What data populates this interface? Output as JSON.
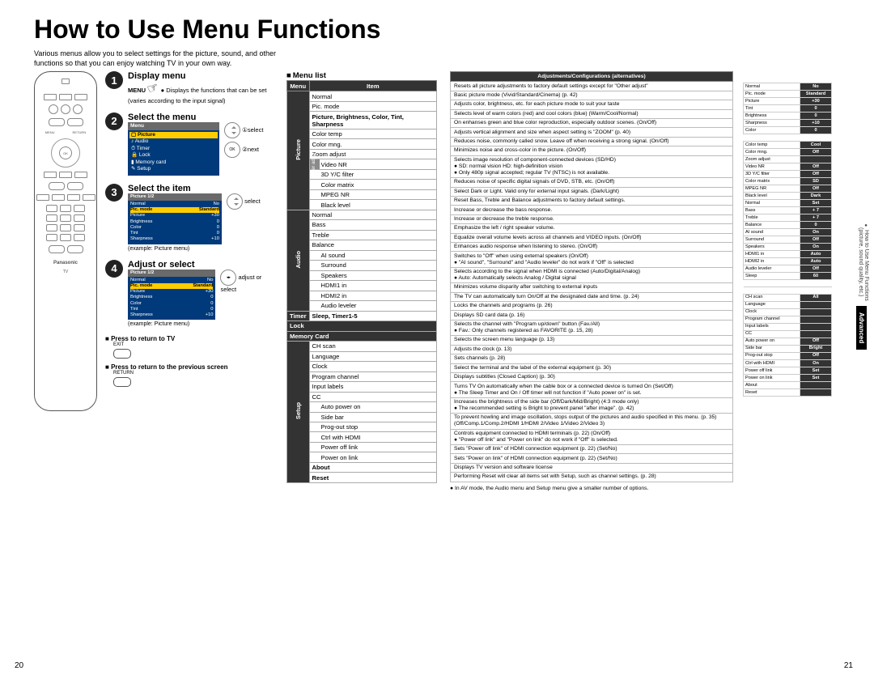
{
  "title": "How to Use Menu Functions",
  "intro": "Various menus allow you to select settings for the picture, sound, and other functions so that you can enjoy watching TV in your own way.",
  "sidetab": {
    "advanced": "Advanced",
    "line1": "How to Use Menu Functions",
    "line2": "(picture, sound quality, etc.)"
  },
  "pageLeft": "20",
  "pageRight": "21",
  "steps": {
    "s1": {
      "title": "Display menu",
      "menu_label": "MENU",
      "desc": "Displays the functions that can be set (varies according to the input signal)"
    },
    "s2": {
      "title": "Select the menu",
      "sel": "select",
      "next": "next",
      "osd": {
        "header": "Menu",
        "items": [
          "Picture",
          "Audio",
          "Timer",
          "Lock",
          "Memory card",
          "Setup"
        ]
      }
    },
    "s3": {
      "title": "Select the item",
      "sel": "select",
      "example": "(example: Picture menu)",
      "osd": {
        "header": "Picture   1/2",
        "rows": [
          [
            "Normal",
            "No"
          ],
          [
            "Pic. mode",
            "Standard"
          ],
          [
            "Picture",
            "+30"
          ],
          [
            "Brightness",
            "0"
          ],
          [
            "Color",
            "0"
          ],
          [
            "Tint",
            "0"
          ],
          [
            "Sharpness",
            "+10"
          ]
        ]
      }
    },
    "s4": {
      "title": "Adjust or select",
      "adj": "adjust or select",
      "example": "(example: Picture menu)",
      "osd": {
        "header": "Picture   1/2",
        "rows": [
          [
            "Normal",
            "No"
          ],
          [
            "Pic. mode",
            "Standard"
          ],
          [
            "Picture",
            "+30"
          ],
          [
            "Brightness",
            "0"
          ],
          [
            "Color",
            "0"
          ],
          [
            "Tint",
            "0"
          ],
          [
            "Sharpness",
            "+10"
          ]
        ]
      }
    }
  },
  "press": {
    "p1": {
      "title": "Press to return to TV",
      "label": "EXIT"
    },
    "p2": {
      "title": "Press to return to the previous screen",
      "label": "RETURN"
    }
  },
  "remote": {
    "brand": "Panasonic",
    "tv": "TV"
  },
  "menulist_title": "Menu list",
  "ml_head": {
    "c1": "Menu",
    "c2": "Item"
  },
  "ml": {
    "picture": {
      "cat": "Picture",
      "rows": [
        "Normal",
        "Pic. mode",
        "Picture, Brightness, Color, Tint, Sharpness",
        "Color temp",
        "Color mng.",
        "Zoom adjust"
      ],
      "other_label": "Other adjust",
      "other": [
        "Video NR",
        "3D Y/C filter",
        "Color matrix",
        "MPEG NR",
        "Black level"
      ]
    },
    "audio": {
      "cat": "Audio",
      "rows": [
        "Normal",
        "Bass",
        "Treble",
        "Balance"
      ],
      "other_label": "Other adjust",
      "other": [
        "AI sound",
        "Surround",
        "Speakers",
        "HDMI1 in",
        "HDMI2 in",
        "Audio leveler"
      ]
    },
    "timer": {
      "cat": "Timer",
      "row": "Sleep, Timer1-5"
    },
    "lock": {
      "cat": "Lock"
    },
    "memory": {
      "cat": "Memory Card"
    },
    "setup": {
      "cat": "Setup",
      "rows": [
        "CH scan",
        "Language",
        "Clock",
        "Program channel",
        "Input labels",
        "CC"
      ],
      "other_label": "Other adjust",
      "other": [
        "Auto power on",
        "Side bar",
        "Prog-out stop",
        "Ctrl with HDMI",
        "Power off link",
        "Power on link"
      ],
      "tail": [
        "About",
        "Reset"
      ]
    }
  },
  "adj_head": "Adjustments/Configurations (alternatives)",
  "adj": [
    "Resets all picture adjustments to factory default settings except for \"Other adjust\"",
    "Basic picture mode (Vivid/Standard/Cinema) (p. 42)",
    "Adjusts color, brightness, etc. for each picture mode to suit your taste",
    "Selects level of warm colors (red) and cool colors (blue) (Warm/Cool/Normal)",
    "On enhanses green and blue color reproduction, especially outdoor scenes. (On/Off)",
    "Adjusts vertical alignment and size when aspect setting is \"ZOOM\" (p. 40)",
    "Reduces noise, commonly called snow. Leave off when receiving a strong signal. (On/Off)",
    "Minimizes noise and cross-color in the picture. (On/Off)",
    "Selects image resolution of component-connected devices (SD/HD)\n● SD: normal vision     HD: high-definition vision\n● Only 480p signal accepted; regular TV (NTSC) is not available.",
    "Reduces noise of specific digital signals of DVD, STB, etc. (On/Off)",
    "Select Dark or Light. Valid only for external input signals. (Dark/Light)",
    "Reset Bass, Treble and Balance adjustments to factory default settings.",
    "Increase or decrease the bass response.",
    "Increase or decrease the treble response.",
    "Emphasize the left / right speaker volume.",
    "Equalize overall volume levels across all channels and VIDEO inputs. (On/Off)",
    "Enhances audio response when listening to stereo. (On/Off)",
    "Switches to \"Off\" when using external speakers (On/Off)\n● \"AI sound\", \"Surround\" and \"Audio leveler\" do not work if \"Off\" is selected",
    "Selects according to the signal when HDMI is connected (Auto/Digital/Analog)\n● Auto: Automatically selects Analog / Digital signal",
    "Minimizes volume disparity after switching to external inputs",
    "The TV can automatically turn On/Off at the designated date and time. (p. 24)",
    "Locks the channels and programs (p. 26)",
    "Displays SD card data (p. 16)",
    "Selects the channel with \"Program up/down\" button (Fav./All)\n● Fav.: Only channels registered as FAVORITE (p. 15, 28)",
    "Selects the screen menu language (p. 13)",
    "Adjusts the clock (p. 13)",
    "Sets channels (p. 28)",
    "Select the terminal and the label of the external equipment (p. 30)",
    "Displays subtitles (Closed Caption) (p. 30)",
    "Turns TV On automatically when the cable box or a connected device is turned On (Set/Off)\n● The Sleep Timer and On / Off timer will not function if \"Auto power on\" is set.",
    "Increases the brightness of the side bar (Off/Dark/Mid/Bright) (4:3 mode only)\n● The recommended setting is Bright to prevent panel \"after image\". (p. 42)",
    "To prevent howling and image oscillation, stops output of the pictures and audio specified in this menu. (p. 35) (Off/Comp.1/Comp.2/HDMI 1/HDMI 2/Video 1/Video 2/Video 3)",
    "Controls equipment connected to HDMI terminals (p. 22) (On/Off)\n● \"Power off link\" and \"Power on link\" do not work if \"Off\" is selected.",
    "Sets \"Power off link\" of HDMI connection equipment (p. 22) (Set/No)",
    "Sets \"Power on link\" of HDMI connection equipment (p. 22) (Set/No)",
    "Displays TV version and software license",
    "Performing Reset will clear all items set with Setup, such as channel settings. (p. 28)"
  ],
  "footnote": "● In AV mode, the Audio menu and Setup menu give a smaller number of options.",
  "mini": [
    [
      "Normal",
      "No"
    ],
    [
      "Pic. mode",
      "Standard"
    ],
    [
      "Picture",
      "+30"
    ],
    [
      "Tint",
      "0"
    ],
    [
      "Brightness",
      "0"
    ],
    [
      "Sharpness",
      "+10"
    ],
    [
      "Color",
      "0"
    ],
    [
      "",
      ""
    ],
    [
      "Color temp",
      "Cool"
    ],
    [
      "Color mng.",
      "Off"
    ],
    [
      "Zoom adjust",
      ""
    ],
    [
      "Video NR",
      "Off"
    ],
    [
      "3D Y/C filter",
      "Off"
    ],
    [
      "Color matrix",
      "SD"
    ],
    [
      "MPEG NR",
      "Off"
    ],
    [
      "Black level",
      "Dark"
    ],
    [
      "Normal",
      "Set"
    ],
    [
      "Bass",
      "+ 7"
    ],
    [
      "Treble",
      "+ 7"
    ],
    [
      "Balance",
      "0"
    ],
    [
      "AI sound",
      "On"
    ],
    [
      "Surround",
      "Off"
    ],
    [
      "Speakers",
      "On"
    ],
    [
      "HDMI1 in",
      "Auto"
    ],
    [
      "HDMI2 in",
      "Auto"
    ],
    [
      "Audio leveler",
      "Off"
    ],
    [
      "Sleep",
      "60"
    ],
    [
      "",
      ""
    ],
    [
      "",
      ""
    ],
    [
      "CH scan",
      "All"
    ],
    [
      "Language",
      ""
    ],
    [
      "Clock",
      ""
    ],
    [
      "Program channel",
      ""
    ],
    [
      "Input labels",
      ""
    ],
    [
      "CC",
      ""
    ],
    [
      "Auto power on",
      "Off"
    ],
    [
      "Side bar",
      "Bright"
    ],
    [
      "Prog-out stop",
      "Off"
    ],
    [
      "Ctrl with HDMI",
      "On"
    ],
    [
      "Power off link",
      "Set"
    ],
    [
      "Power on link",
      "Set"
    ],
    [
      "About",
      ""
    ],
    [
      "Reset",
      ""
    ]
  ]
}
